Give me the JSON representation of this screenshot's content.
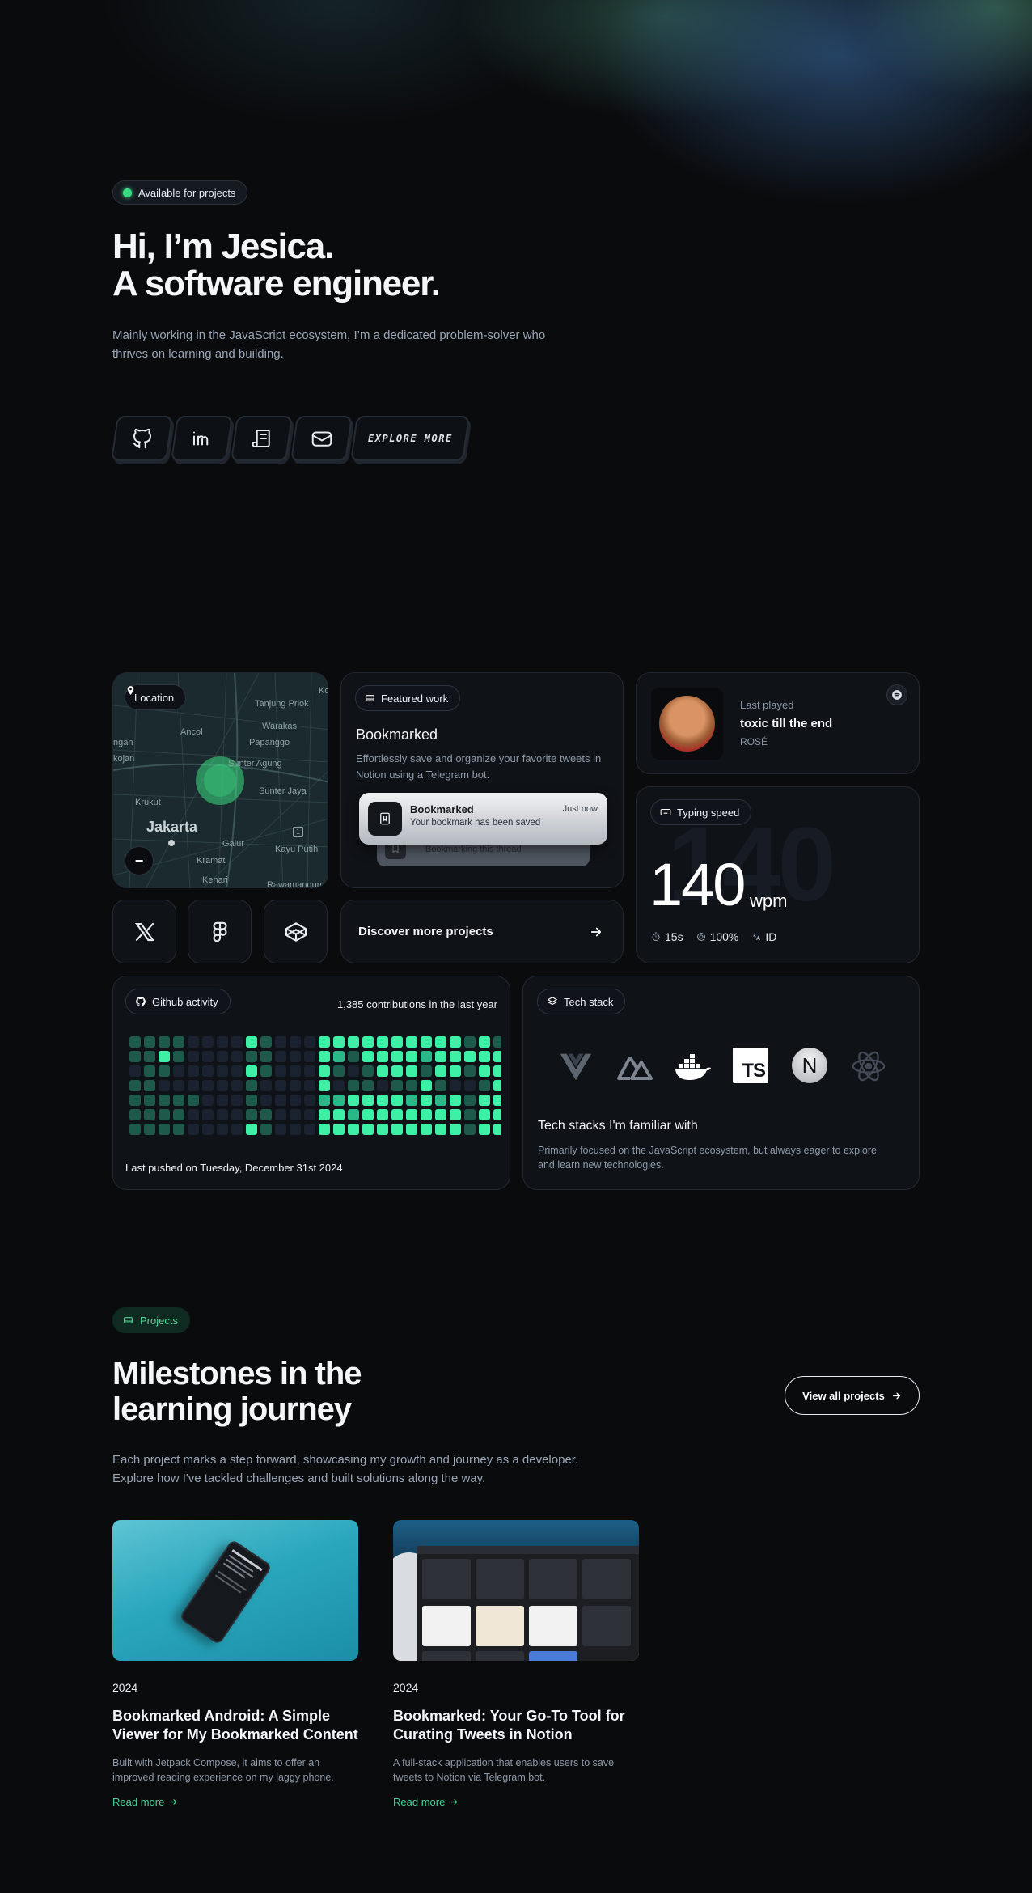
{
  "hero": {
    "badge": "Available for projects",
    "title_line1": "Hi, I’m Jesica.",
    "title_line2": "A software engineer.",
    "description": "Mainly working in the JavaScript ecosystem, I’m a dedicated problem-solver who thrives on learning and building.",
    "buttons": [
      {
        "icon": "github-icon"
      },
      {
        "icon": "linkedin-icon"
      },
      {
        "icon": "resume-icon"
      },
      {
        "icon": "mail-icon"
      }
    ],
    "explore_label": "EXPLORE MORE"
  },
  "location": {
    "label": "Location",
    "city": "Jakarta",
    "zoom_out": "−",
    "places": [
      "Tanjung Priok",
      "Ancol",
      "Warakas",
      "Papanggo",
      "ngan",
      "Sunter Agung",
      "kojan",
      "Sunter Jaya",
      "Krukut",
      "Galur",
      "Kayu Putih",
      "Kramat",
      "Kenari",
      "Rawamangun",
      "Ko"
    ],
    "road_marker": "1"
  },
  "featured": {
    "label": "Featured work",
    "title": "Bookmarked",
    "description": "Effortlessly save and organize your favorite tweets in Notion using a Telegram bot.",
    "notification_title": "Bookmarked",
    "notification_body": "Your bookmark has been saved",
    "notification_time": "Just now",
    "notification_back": "Bookmarking this thread"
  },
  "spotify": {
    "label": "Last played",
    "song": "toxic till the end",
    "artist": "ROSÉ"
  },
  "typing": {
    "label": "Typing speed",
    "wpm": "140",
    "unit": "wpm",
    "bg_number": "140",
    "time": "15s",
    "accuracy": "100%",
    "lang": "ID"
  },
  "socials": [
    {
      "icon": "x-icon"
    },
    {
      "icon": "figma-icon"
    },
    {
      "icon": "codepen-icon"
    }
  ],
  "discover": {
    "label": "Discover more projects"
  },
  "github": {
    "label": "Github activity",
    "contributions": "1,385 contributions in the last year",
    "last_pushed": "Last pushed on Tuesday, December 31st 2024",
    "weeks": [
      [
        1,
        1,
        0,
        1,
        1,
        1,
        1
      ],
      [
        1,
        1,
        1,
        1,
        1,
        1,
        1
      ],
      [
        1,
        3,
        1,
        0,
        1,
        1,
        1
      ],
      [
        1,
        1,
        0,
        0,
        1,
        1,
        1
      ],
      [
        0,
        0,
        0,
        0,
        1,
        0,
        0
      ],
      [
        0,
        0,
        0,
        0,
        0,
        0,
        0
      ],
      [
        0,
        0,
        0,
        0,
        0,
        0,
        0
      ],
      [
        0,
        0,
        0,
        0,
        0,
        0,
        0
      ],
      [
        3,
        1,
        3,
        1,
        1,
        1,
        3
      ],
      [
        1,
        1,
        1,
        0,
        0,
        1,
        1
      ],
      [
        0,
        0,
        0,
        0,
        0,
        0,
        0
      ],
      [
        0,
        0,
        0,
        0,
        0,
        0,
        0
      ],
      [
        0,
        0,
        0,
        0,
        0,
        0,
        0
      ],
      [
        3,
        3,
        3,
        3,
        2,
        3,
        3
      ],
      [
        3,
        2,
        1,
        0,
        2,
        3,
        3
      ],
      [
        3,
        1,
        0,
        1,
        3,
        2,
        3
      ],
      [
        3,
        3,
        1,
        1,
        3,
        3,
        3
      ],
      [
        3,
        3,
        3,
        0,
        3,
        3,
        3
      ],
      [
        3,
        3,
        3,
        1,
        3,
        3,
        3
      ],
      [
        3,
        3,
        3,
        1,
        2,
        3,
        3
      ],
      [
        3,
        2,
        1,
        3,
        3,
        3,
        3
      ],
      [
        3,
        3,
        3,
        1,
        2,
        3,
        3
      ],
      [
        3,
        3,
        3,
        0,
        3,
        3,
        3
      ],
      [
        1,
        3,
        1,
        0,
        1,
        1,
        1
      ],
      [
        3,
        3,
        3,
        1,
        3,
        3,
        3
      ],
      [
        1,
        3,
        3,
        3,
        3,
        3,
        3
      ]
    ],
    "palette": [
      "#1a2230",
      "#1e5a4b",
      "#2bb888",
      "#3df0a6"
    ]
  },
  "tech": {
    "label": "Tech stack",
    "icons": [
      "vue-icon",
      "nuxt-icon",
      "docker-icon",
      "typescript-icon",
      "nextjs-icon",
      "react-icon"
    ],
    "ts_label": "TS",
    "next_label": "N",
    "title": "Tech stacks I'm familiar with",
    "description": "Primarily focused on the JavaScript ecosystem, but always eager to explore and learn new technologies."
  },
  "projects_section": {
    "badge": "Projects",
    "title_line1": "Milestones in the",
    "title_line2": "learning journey",
    "view_all": "View all projects",
    "description": "Each project marks a step forward, showcasing my growth and journey as a developer. Explore how I've tackled challenges and built solutions along the way.",
    "items": [
      {
        "year": "2024",
        "title": "Bookmarked Android: A Simple Viewer for My Bookmarked Content",
        "description": "Built with Jetpack Compose, it aims to offer an improved reading experience on my laggy phone.",
        "link": "Read more"
      },
      {
        "year": "2024",
        "title": "Bookmarked: Your Go-To Tool for Curating Tweets in Notion",
        "description": "A full-stack application that enables users to save tweets to Notion via Telegram bot.",
        "link": "Read more"
      }
    ]
  },
  "colors": {
    "accent": "#3ddc84",
    "link": "#49d29a",
    "background": "#0a0b0d"
  }
}
